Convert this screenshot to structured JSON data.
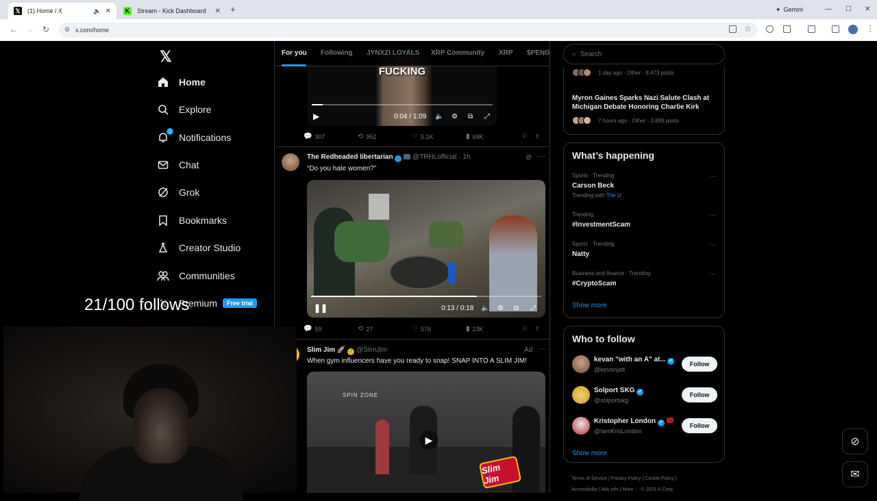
{
  "browser": {
    "tabs": [
      {
        "title": "(1) Home / X",
        "favicon": "x-logo-icon"
      },
      {
        "title": "Stream - Kick Dashboard",
        "favicon": "kick-icon"
      }
    ],
    "url": "x.com/home",
    "gemini_label": "Gemini"
  },
  "leftnav": {
    "items": [
      {
        "label": "Home",
        "icon": "home-icon"
      },
      {
        "label": "Explore",
        "icon": "search-icon"
      },
      {
        "label": "Notifications",
        "icon": "bell-icon",
        "badge": "1"
      },
      {
        "label": "Chat",
        "icon": "mail-icon"
      },
      {
        "label": "Grok",
        "icon": "grok-icon"
      },
      {
        "label": "Bookmarks",
        "icon": "bookmark-icon"
      },
      {
        "label": "Creator Studio",
        "icon": "flask-icon"
      },
      {
        "label": "Communities",
        "icon": "people-icon"
      },
      {
        "label": "Premium",
        "icon": "x-logo-icon"
      }
    ],
    "free_trial": "Free trial"
  },
  "overlay_text": "21/100 follows",
  "timeline": {
    "tabs": [
      "For you",
      "Following",
      "JYNXZI LOYALS",
      "XRP Community",
      "XRP",
      "$PENG"
    ],
    "post1": {
      "caption": "FUCKING",
      "time": "0:04 / 1:09",
      "progress": 0.06,
      "stats": {
        "replies": "307",
        "reposts": "952",
        "likes": "5.1K",
        "views": "69K"
      }
    },
    "post2": {
      "name": "The Redheaded libertarian",
      "handle": "@TRHLofficial",
      "age": "· 1h",
      "text": "“Do you hate women?”",
      "time": "0:13 / 0:18",
      "progress": 0.72,
      "stats": {
        "replies": "59",
        "reposts": "27",
        "likes": "576",
        "views": "23K"
      }
    },
    "post3": {
      "name": "Slim Jim",
      "handle": "@SlimJim",
      "ad": "Ad",
      "text": "When gym influencers have you ready to snap! SNAP INTO A SLIM JIM!",
      "brand": "Slim Jim",
      "sign": "SPIN ZONE"
    }
  },
  "rightcol": {
    "search_placeholder": "Search",
    "top_card": {
      "meta1": "1 day ago · Other · 8,473 posts",
      "headline": "Myron Gaines Sparks Nazi Salute Clash at Michigan Debate Honoring Charlie Kirk",
      "meta2": "7 hours ago · Other · 3,895 posts"
    },
    "happening": {
      "title": "What’s happening",
      "trends": [
        {
          "context": "Sports · Trending",
          "name": "Carson Beck",
          "with_label": "Trending with",
          "with": "The U"
        },
        {
          "context": "Trending",
          "name": "#InvestmentScam"
        },
        {
          "context": "Sports · Trending",
          "name": "Natty"
        },
        {
          "context": "Business and finance · Trending",
          "name": "#CryptoScam"
        }
      ],
      "show_more": "Show more"
    },
    "who_to_follow": {
      "title": "Who to follow",
      "users": [
        {
          "name": "kevan \"with an A\" at...",
          "handle": "@kevanjatt",
          "button": "Follow"
        },
        {
          "name": "Solport SKG",
          "handle": "@solportskg",
          "button": "Follow"
        },
        {
          "name": "Kristopher London",
          "handle": "@IamKrisLondon",
          "button": "Follow"
        }
      ],
      "show_more": "Show more"
    },
    "footer1": "Terms of Service  |  Privacy Policy  |  Cookie Policy  |",
    "footer2": "Accessibility  |  Ads info  |  More ···  © 2025 X Corp."
  }
}
